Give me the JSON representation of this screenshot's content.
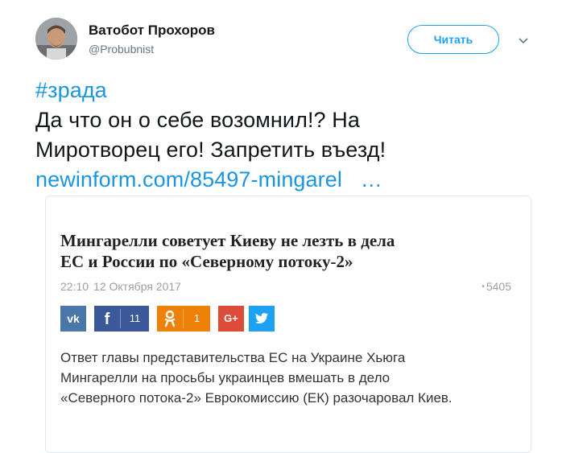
{
  "author": {
    "display_name": "Ватобот Прохоров",
    "handle": "@Probubnist"
  },
  "actions": {
    "follow_label": "Читать"
  },
  "tweet": {
    "hashtag": "#зрада",
    "text_line1": "Да что он о себе возомнил!? На",
    "text_line2": "Миротворец его! Запретить въезд!",
    "link_text": "newinform.com/85497-mingarel",
    "link_ellipsis": "…"
  },
  "card": {
    "title_line1": "Мингарелли советует Киеву не лезть в дела",
    "title_line2": "ЕС и России по «Северному потоку-2»",
    "time": "22:10",
    "date": "12 Октября 2017",
    "views_dot": "•",
    "views": "5405",
    "share": {
      "vk_icon": "vk-icon",
      "facebook_icon": "facebook-icon",
      "facebook_count": "11",
      "ok_icon": "odnoklassniki-icon",
      "ok_count": "1",
      "gplus_label": "G+",
      "twitter_icon": "twitter-bird-icon"
    },
    "excerpt_line1": "Ответ главы представительства ЕС на Украине Хьюга",
    "excerpt_line2": "Мингарелли на просьбы украинцев вмешать в дело",
    "excerpt_line3": "«Северного потока-2» Еврокомиссию (ЕК) разочаровал Киев."
  },
  "colors": {
    "link": "#1b95e0",
    "follow_accent": "#1da1f2",
    "vk": "#4a76a8",
    "facebook": "#3b5998",
    "ok": "#ee8208",
    "gplus": "#dd4b39",
    "twitter": "#1da1f2"
  }
}
